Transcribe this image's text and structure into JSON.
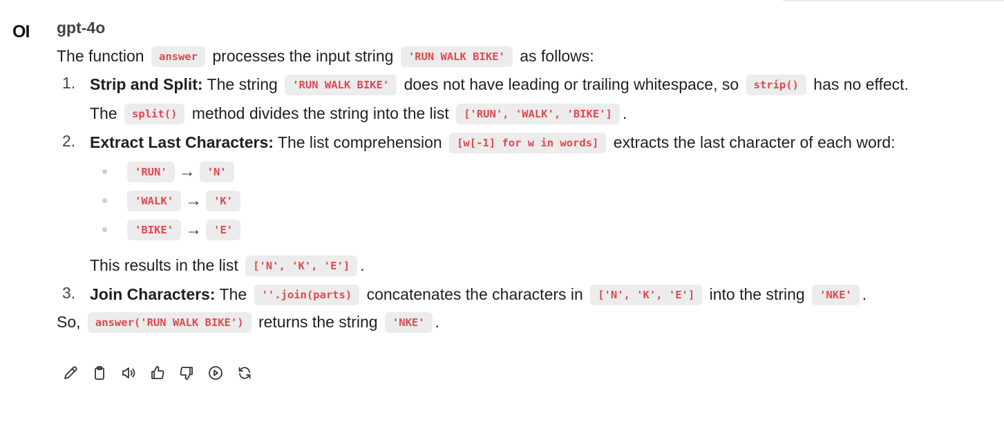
{
  "avatar": {
    "text": "OI"
  },
  "model": {
    "name": "gpt-4o"
  },
  "intro": {
    "pre": "The function",
    "code1": "answer",
    "mid": "processes the input string",
    "code2": "'RUN WALK BIKE'",
    "post": "as follows:"
  },
  "steps": [
    {
      "number": "1.",
      "title": "Strip and Split:",
      "text1": "The string",
      "code1": "'RUN WALK BIKE'",
      "text2": "does not have leading or trailing whitespace, so",
      "code2": "strip()",
      "text3": "has no effect.",
      "text4": "The",
      "code3": "split()",
      "text5": "method divides the string into the list",
      "code4": "['RUN', 'WALK', 'BIKE']",
      "text6": "."
    },
    {
      "number": "2.",
      "title": "Extract Last Characters:",
      "text1": "The list comprehension",
      "code1": "[w[-1] for w in words]",
      "text2": "extracts the last character of each word:",
      "bullets": [
        {
          "from": "'RUN'",
          "arrow": "→",
          "to": "'N'"
        },
        {
          "from": "'WALK'",
          "arrow": "→",
          "to": "'K'"
        },
        {
          "from": "'BIKE'",
          "arrow": "→",
          "to": "'E'"
        }
      ],
      "result_text": "This results in the list",
      "result_code": "['N', 'K', 'E']",
      "result_end": "."
    },
    {
      "number": "3.",
      "title": "Join Characters:",
      "text1": "The",
      "code1": "''.join(parts)",
      "text2": "concatenates the characters in",
      "code2": "['N', 'K', 'E']",
      "text3": "into the string",
      "code3": "'NKE'",
      "text4": "."
    }
  ],
  "summary": {
    "pre": "So,",
    "code1": "answer('RUN WALK BIKE')",
    "mid": "returns the string",
    "code2": "'NKE'",
    "post": "."
  },
  "toolbar": {
    "icons": [
      "edit-icon",
      "copy-icon",
      "read-aloud-icon",
      "thumbs-up-icon",
      "thumbs-down-icon",
      "continue-icon",
      "regenerate-icon"
    ]
  }
}
